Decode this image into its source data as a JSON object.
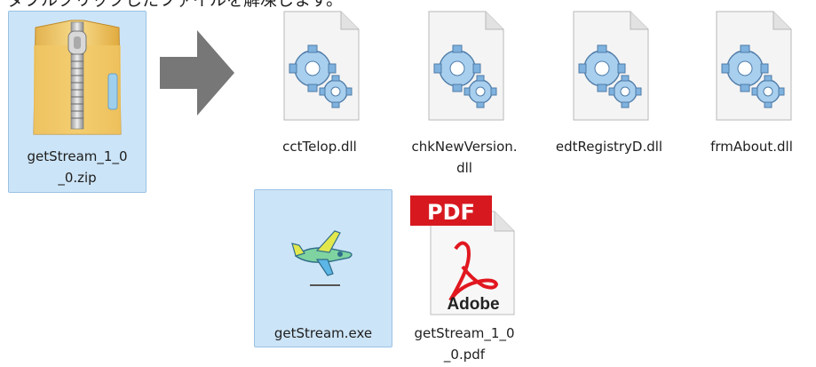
{
  "caption": "ダブルクリックしたファイルを解凍します。",
  "zip": {
    "label_line1": "getStream_1_0",
    "label_line2": "_0.zip",
    "icon": "zip-folder-icon"
  },
  "arrow_icon": "right-arrow-icon",
  "files": [
    {
      "line1": "cctTelop.dll",
      "line2": "",
      "icon": "dll-gear-icon"
    },
    {
      "line1": "chkNewVersion.",
      "line2": "dll",
      "icon": "dll-gear-icon"
    },
    {
      "line1": "edtRegistryD.dll",
      "line2": "",
      "icon": "dll-gear-icon"
    },
    {
      "line1": "frmAbout.dll",
      "line2": "",
      "icon": "dll-gear-icon"
    },
    {
      "line1": "getStream.exe",
      "line2": "",
      "icon": "airplane-exe-icon"
    },
    {
      "line1": "getStream_1_0",
      "line2": "_0.pdf",
      "icon": "pdf-icon",
      "badge": "PDF",
      "brand": "Adobe"
    }
  ]
}
